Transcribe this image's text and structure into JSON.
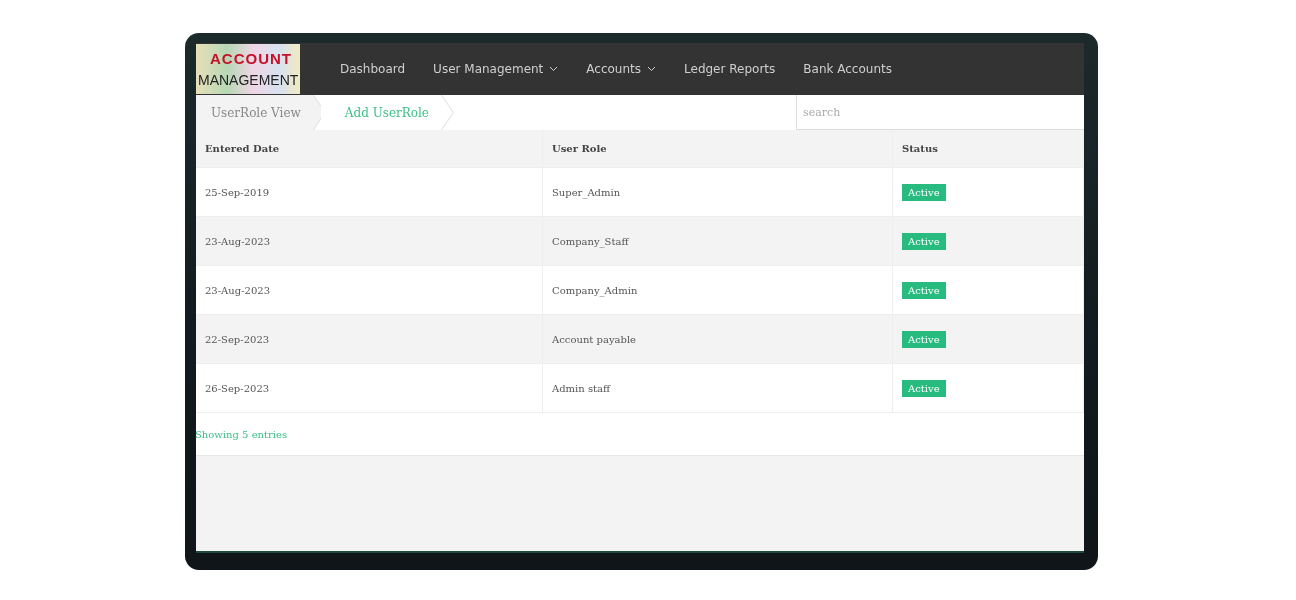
{
  "logo": {
    "line_1": "ACCOUNT",
    "line_2": "MANAGEMENT"
  },
  "nav": [
    {
      "label": "Dashboard",
      "dropdown": false
    },
    {
      "label": "User Management",
      "dropdown": true
    },
    {
      "label": "Accounts",
      "dropdown": true
    },
    {
      "label": "Ledger Reports",
      "dropdown": false
    },
    {
      "label": "Bank Accounts",
      "dropdown": false
    }
  ],
  "breadcrumb": [
    {
      "label": "UserRole View",
      "selected": true
    },
    {
      "label": "Add UserRole",
      "selected": false
    }
  ],
  "search": {
    "placeholder": "search"
  },
  "table": {
    "columns": [
      "Entered Date",
      "User Role",
      "Status"
    ],
    "rows": [
      {
        "date": "25-Sep-2019",
        "role": "Super_Admin",
        "status": "Active"
      },
      {
        "date": "23-Aug-2023",
        "role": "Company_Staff",
        "status": "Active"
      },
      {
        "date": "23-Aug-2023",
        "role": "Company_Admin",
        "status": "Active"
      },
      {
        "date": "22-Sep-2023",
        "role": "Account payable",
        "status": "Active"
      },
      {
        "date": "26-Sep-2023",
        "role": "Admin staff",
        "status": "Active"
      }
    ]
  },
  "footer": "Showing 5 entries"
}
